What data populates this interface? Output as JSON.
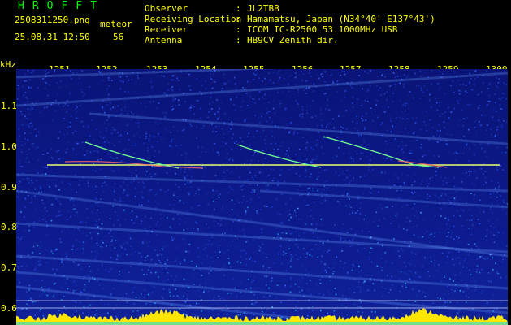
{
  "header": {
    "app_title": "HROFFT",
    "filename": "2508311250.png",
    "meteor_label": "meteor",
    "datetime": "25.08.31 12:50",
    "meteor_count": "56"
  },
  "station": {
    "observer_label": "Observer",
    "observer_value": "JL2TBB",
    "location_label": "Receiving Location",
    "location_value": "Hamamatsu, Japan (N34°40' E137°43')",
    "receiver_label": "Receiver",
    "receiver_value": "ICOM IC-R2500 53.1000MHz USB",
    "antenna_label": "Antenna",
    "antenna_value": "HB9CV Zenith dir.",
    "separator": ":"
  },
  "axes": {
    "y_unit": "kHz",
    "x_ticks": [
      "1251",
      "1252",
      "1253",
      "1254",
      "1255",
      "1256",
      "1257",
      "1258",
      "1259",
      "1300"
    ],
    "y_ticks": [
      "1.1",
      "1.0",
      "0.9",
      "0.8",
      "0.7",
      "0.6"
    ]
  },
  "colors": {
    "text_primary": "#ffff00",
    "title": "#00ff00",
    "background": "#000000",
    "noise_base": "#0a1a8c",
    "signal_trace": "#ffff80",
    "noise_floor": "#ffe600"
  }
}
